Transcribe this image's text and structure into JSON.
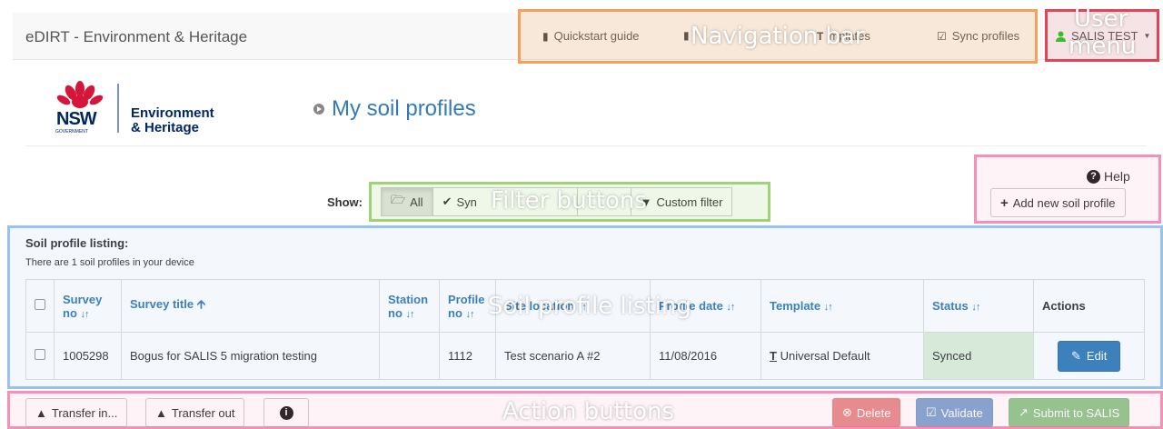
{
  "navbar": {
    "brand": "eDIRT - Environment & Heritage",
    "quickstart": "Quickstart guide",
    "templates": "mplates",
    "sync": "Sync profiles",
    "user": "SALIS TEST"
  },
  "logo": {
    "line1": "NSW",
    "line2": "GOVERNMENT",
    "org1": "Environment",
    "org2": "& Heritage"
  },
  "page": {
    "title": "My soil profiles"
  },
  "filters": {
    "show_label": "Show:",
    "all": "All",
    "synced": "Syn",
    "custom": "Custom filter"
  },
  "help": {
    "label": "Help"
  },
  "add_button": "Add new soil profile",
  "listing": {
    "title": "Soil profile listing:",
    "subtitle": "There are 1 soil profiles in your device",
    "columns": {
      "survey_no_1": "Survey",
      "survey_no_2": "no",
      "survey_title": "Survey title",
      "station_1": "Station",
      "station_2": "no",
      "profile_1": "Profile",
      "profile_2": "no",
      "site": "Site location",
      "date": "Profile date",
      "template": "Template",
      "status": "Status",
      "actions": "Actions"
    },
    "rows": [
      {
        "survey_no": "1005298",
        "survey_title": "Bogus for SALIS 5 migration testing",
        "station_no": "",
        "profile_no": "1112",
        "site_location": "Test scenario A #2",
        "profile_date": "11/08/2016",
        "template": "Universal Default",
        "status": "Synced",
        "action": "Edit"
      }
    ]
  },
  "actions": {
    "transfer_in": "Transfer in...",
    "transfer_out": "Transfer out",
    "delete": "Delete",
    "validate": "Validate",
    "submit": "Submit to SALIS"
  },
  "annotations": {
    "navigation": "Navigation bar",
    "user_menu_1": "User",
    "user_menu_2": "menu",
    "filter": "Filter buttons",
    "listing": "Soil profile listing",
    "action": "Action buttons"
  },
  "colors": {
    "link": "#337ab7",
    "synced_bg": "#dff0d8",
    "user_icon": "#22cc22"
  }
}
